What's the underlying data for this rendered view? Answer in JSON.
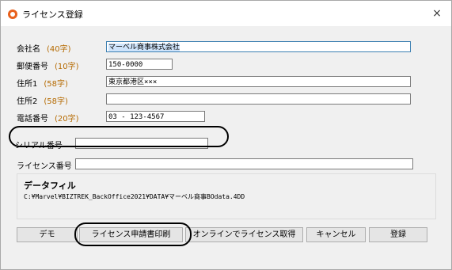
{
  "window": {
    "title": "ライセンス登録",
    "close_glyph": "×"
  },
  "form": {
    "company": {
      "label": "会社名",
      "hint": "(40字)",
      "value": "マーベル商事株式会社"
    },
    "postal": {
      "label": "郵便番号",
      "hint": "(10字)",
      "value": "150-0000"
    },
    "address1": {
      "label": "住所1",
      "hint": "(58字)",
      "value": "東京都港区×××"
    },
    "address2": {
      "label": "住所2",
      "hint": "(58字)",
      "value": ""
    },
    "phone": {
      "label": "電話番号",
      "hint": "(20字)",
      "value": "03 - 123-4567"
    },
    "serial": {
      "label": "シリアル番号",
      "value": ""
    },
    "license": {
      "label": "ライセンス番号",
      "value": ""
    }
  },
  "data_file": {
    "title": "データフィル",
    "path": "C:¥Marvel¥BIZTREK_BackOffice2021¥DATA¥マーベル商事BOdata.4DD"
  },
  "buttons": {
    "demo": "デモ",
    "print": "ライセンス申請書印刷",
    "online": "オンラインでライセンス取得",
    "cancel": "キャンセル",
    "register": "登録"
  },
  "colors": {
    "hint": "#b56a00",
    "accent": "#e8601c",
    "focus_border": "#3c7fb1"
  }
}
